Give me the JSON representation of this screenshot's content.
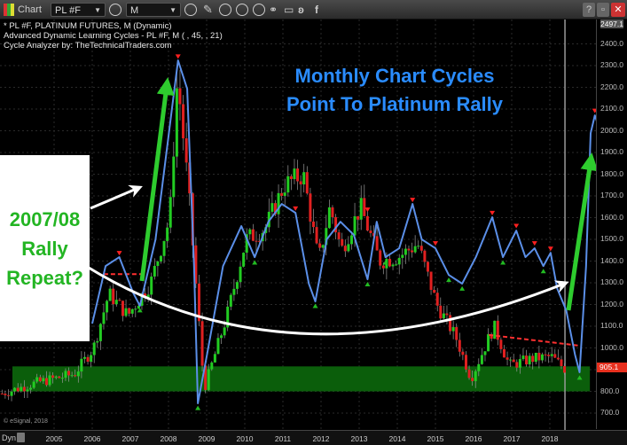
{
  "window": {
    "app_title": "Chart",
    "symbol": "PL #F",
    "interval": "M",
    "buttons": [
      "help",
      "restore",
      "close"
    ]
  },
  "toolbar_icons": [
    "pencil-icon",
    "refresh-icon",
    "play-icon",
    "alert-icon",
    "link-icon",
    "comment-icon",
    "twitter-icon",
    "facebook-icon"
  ],
  "legend": {
    "line1": "* PL #F, PLATINUM FUTURES, M (Dynamic)",
    "line2": "Advanced Dynamic Learning Cycles - PL #F, M (        , 45,          , 21)",
    "line3": "Cycle Analyzer by: TheTechnicalTraders.com"
  },
  "annotations": {
    "headline_line1": "Monthly Chart Cycles",
    "headline_line2": "Point To Platinum Rally",
    "callout_line1": "2007/08",
    "callout_line2": "Rally",
    "callout_line3": "Repeat?"
  },
  "copyright": "© eSignal, 2018",
  "xaxis_mode": "Dyn",
  "last_price": "905.1",
  "colors": {
    "up": "#22cc22",
    "down": "#e02020",
    "cycle": "#5b8fe8",
    "support_zone": "#0b5e0b",
    "headline": "#2a8cff",
    "callout_text": "#23b523"
  },
  "chart_data": {
    "type": "candlestick",
    "instrument": "PL #F, PLATINUM FUTURES",
    "interval": "Monthly",
    "y_ticks": [
      "2497.1",
      "2400.0",
      "2300.0",
      "2200.0",
      "2100.0",
      "2000.0",
      "1900.0",
      "1800.0",
      "1700.0",
      "1600.0",
      "1500.0",
      "1400.0",
      "1300.0",
      "1200.0",
      "1100.0",
      "1000.0",
      "900.0",
      "800.0",
      "700.0"
    ],
    "x_ticks": [
      "2005",
      "2006",
      "2007",
      "2008",
      "2009",
      "2010",
      "2011",
      "2012",
      "2013",
      "2014",
      "2015",
      "2016",
      "2017",
      "2018"
    ],
    "ylim": [
      620,
      2497.1
    ],
    "price_path_approx": [
      [
        2003.6,
        790
      ],
      [
        2004.5,
        840
      ],
      [
        2005.5,
        880
      ],
      [
        2006.0,
        1000
      ],
      [
        2006.4,
        1250
      ],
      [
        2006.9,
        1150
      ],
      [
        2007.5,
        1300
      ],
      [
        2008.0,
        1600
      ],
      [
        2008.2,
        2250
      ],
      [
        2008.5,
        1700
      ],
      [
        2008.9,
        810
      ],
      [
        2009.5,
        1150
      ],
      [
        2010.0,
        1500
      ],
      [
        2010.5,
        1550
      ],
      [
        2011.0,
        1750
      ],
      [
        2011.5,
        1800
      ],
      [
        2011.9,
        1400
      ],
      [
        2012.2,
        1650
      ],
      [
        2012.5,
        1450
      ],
      [
        2013.0,
        1650
      ],
      [
        2013.5,
        1400
      ],
      [
        2014.0,
        1420
      ],
      [
        2014.5,
        1480
      ],
      [
        2015.0,
        1200
      ],
      [
        2015.5,
        1050
      ],
      [
        2015.9,
        860
      ],
      [
        2016.5,
        1100
      ],
      [
        2016.9,
        920
      ],
      [
        2017.5,
        950
      ],
      [
        2018.0,
        960
      ],
      [
        2018.35,
        905
      ]
    ],
    "cycle_line": [
      [
        2006.0,
        1112
      ],
      [
        2006.35,
        1377
      ],
      [
        2006.71,
        1418
      ],
      [
        2007.07,
        1255
      ],
      [
        2007.25,
        1194
      ],
      [
        2007.66,
        1500
      ],
      [
        2008.01,
        1989
      ],
      [
        2008.25,
        2324
      ],
      [
        2008.49,
        2193
      ],
      [
        2008.67,
        1377
      ],
      [
        2008.77,
        745
      ],
      [
        2009.01,
        969
      ],
      [
        2009.43,
        1377
      ],
      [
        2009.91,
        1561
      ],
      [
        2010.26,
        1418
      ],
      [
        2010.62,
        1581
      ],
      [
        2010.97,
        1663
      ],
      [
        2011.33,
        1622
      ],
      [
        2011.68,
        1296
      ],
      [
        2011.85,
        1214
      ],
      [
        2012.15,
        1500
      ],
      [
        2012.51,
        1581
      ],
      [
        2012.86,
        1520
      ],
      [
        2013.22,
        1316
      ],
      [
        2013.46,
        1581
      ],
      [
        2013.69,
        1418
      ],
      [
        2014.05,
        1459
      ],
      [
        2014.4,
        1663
      ],
      [
        2014.64,
        1500
      ],
      [
        2015.0,
        1459
      ],
      [
        2015.35,
        1336
      ],
      [
        2015.7,
        1296
      ],
      [
        2016.06,
        1418
      ],
      [
        2016.49,
        1602
      ],
      [
        2016.77,
        1418
      ],
      [
        2017.12,
        1540
      ],
      [
        2017.36,
        1418
      ],
      [
        2017.6,
        1459
      ],
      [
        2017.83,
        1377
      ],
      [
        2018.02,
        1438
      ],
      [
        2018.19,
        1275
      ],
      [
        2018.43,
        1173
      ],
      [
        2018.66,
        969
      ],
      [
        2018.78,
        888
      ],
      [
        2018.95,
        1377
      ],
      [
        2019.07,
        1989
      ],
      [
        2019.18,
        2071
      ],
      [
        2019.3,
        2010
      ]
    ],
    "cycle_peaks": [
      [
        2006.71,
        1430
      ],
      [
        2008.25,
        2335
      ],
      [
        2011.33,
        1635
      ],
      [
        2013.22,
        1630
      ],
      [
        2014.4,
        1675
      ],
      [
        2015.0,
        1475
      ],
      [
        2016.49,
        1615
      ],
      [
        2017.12,
        1555
      ],
      [
        2017.6,
        1475
      ],
      [
        2018.02,
        1450
      ],
      [
        2019.18,
        2085
      ]
    ],
    "cycle_troughs": [
      [
        2007.25,
        1180
      ],
      [
        2008.77,
        730
      ],
      [
        2010.26,
        1400
      ],
      [
        2011.85,
        1200
      ],
      [
        2013.22,
        1300
      ],
      [
        2013.69,
        1400
      ],
      [
        2015.35,
        1320
      ],
      [
        2015.7,
        1280
      ],
      [
        2016.77,
        1400
      ],
      [
        2017.83,
        1360
      ],
      [
        2018.78,
        870
      ]
    ],
    "support_zone": [
      800,
      915
    ],
    "resistance_lines": [
      [
        [
          2006.3,
          1340
        ],
        [
          2007.4,
          1340
        ]
      ],
      [
        [
          2016.4,
          1060
        ],
        [
          2018.8,
          1010
        ]
      ]
    ],
    "current_bar_marker": 2018.35
  }
}
